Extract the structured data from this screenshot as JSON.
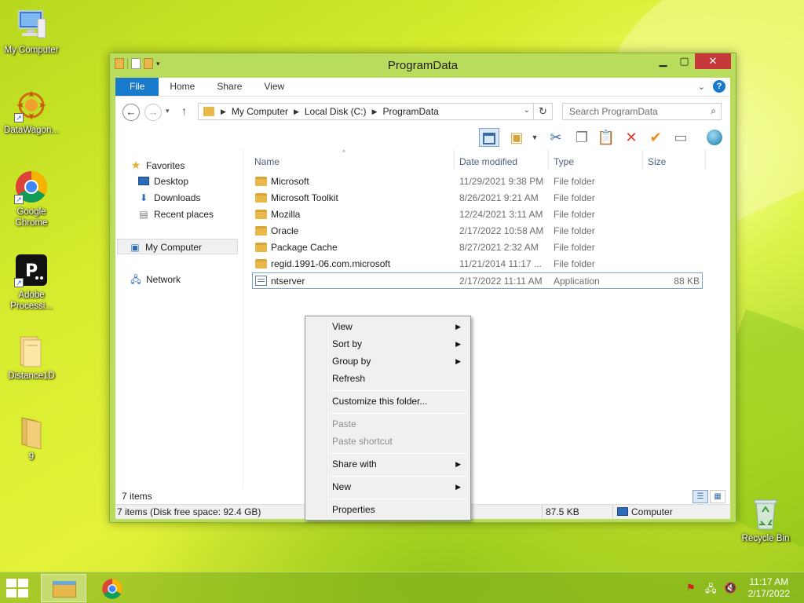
{
  "desktop": {
    "icons": [
      {
        "label": "My Computer"
      },
      {
        "label": "DataWagon..."
      },
      {
        "label": "Google Chrome"
      },
      {
        "label": "Adobe Processi..."
      },
      {
        "label": "Distance1D"
      },
      {
        "label": "9"
      },
      {
        "label": "Recycle Bin"
      }
    ]
  },
  "window": {
    "title": "ProgramData",
    "tabs": [
      "File",
      "Home",
      "Share",
      "View"
    ],
    "breadcrumbs": [
      "My Computer",
      "Local Disk (C:)",
      "ProgramData"
    ],
    "search_placeholder": "Search ProgramData",
    "navpane": {
      "favorites": "Favorites",
      "desktop": "Desktop",
      "downloads": "Downloads",
      "recent": "Recent places",
      "computer": "My Computer",
      "network": "Network"
    },
    "columns": [
      "Name",
      "Date modified",
      "Type",
      "Size"
    ],
    "files": [
      {
        "name": "Microsoft",
        "date": "11/29/2021 9:38 PM",
        "type": "File folder",
        "size": ""
      },
      {
        "name": "Microsoft Toolkit",
        "date": "8/26/2021 9:21 AM",
        "type": "File folder",
        "size": ""
      },
      {
        "name": "Mozilla",
        "date": "12/24/2021 3:11 AM",
        "type": "File folder",
        "size": ""
      },
      {
        "name": "Oracle",
        "date": "2/17/2022 10:58 AM",
        "type": "File folder",
        "size": ""
      },
      {
        "name": "Package Cache",
        "date": "8/27/2021 2:32 AM",
        "type": "File folder",
        "size": ""
      },
      {
        "name": "regid.1991-06.com.microsoft",
        "date": "11/21/2014 11:17 ...",
        "type": "File folder",
        "size": ""
      },
      {
        "name": "ntserver",
        "date": "2/17/2022 11:11 AM",
        "type": "Application",
        "size": "88 KB"
      }
    ],
    "item_count": "7 items",
    "status": {
      "left": "7 items (Disk free space: 92.4 GB)",
      "size": "87.5 KB",
      "location": "Computer"
    }
  },
  "context_menu": {
    "view": "View",
    "sort_by": "Sort by",
    "group_by": "Group by",
    "refresh": "Refresh",
    "customize": "Customize this folder...",
    "paste": "Paste",
    "paste_shortcut": "Paste shortcut",
    "share_with": "Share with",
    "new": "New",
    "properties": "Properties"
  },
  "taskbar": {
    "time": "11:17 AM",
    "date": "2/17/2022"
  }
}
